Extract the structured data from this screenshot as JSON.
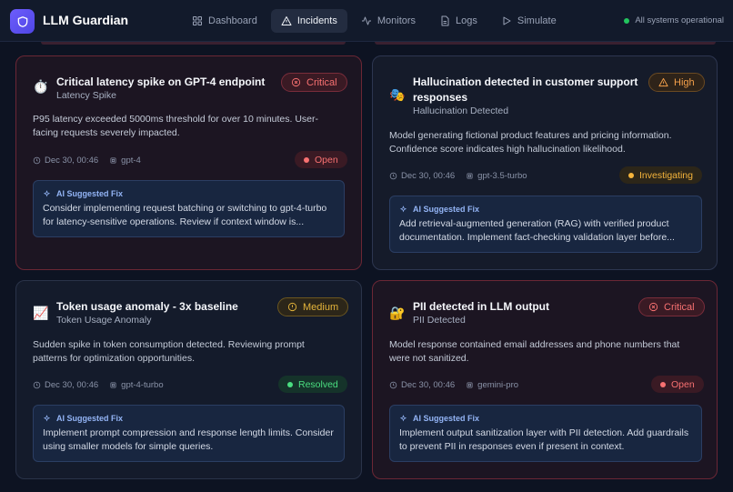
{
  "app": {
    "name": "LLM Guardian"
  },
  "nav": [
    {
      "label": "Dashboard",
      "icon": "dashboard-icon",
      "active": false
    },
    {
      "label": "Incidents",
      "icon": "alert-triangle-icon",
      "active": true
    },
    {
      "label": "Monitors",
      "icon": "activity-icon",
      "active": false
    },
    {
      "label": "Logs",
      "icon": "file-icon",
      "active": false
    },
    {
      "label": "Simulate",
      "icon": "play-icon",
      "active": false
    }
  ],
  "system_status": {
    "text": "All systems operational",
    "color": "#22c55e"
  },
  "fix_label": "AI Suggested Fix",
  "incidents": [
    {
      "emoji": "⏱️",
      "title": "Critical latency spike on GPT-4 endpoint",
      "category": "Latency Spike",
      "severity": "Critical",
      "description": "P95 latency exceeded 5000ms threshold for over 10 minutes. User-facing requests severely impacted.",
      "time": "Dec 30, 00:46",
      "model": "gpt-4",
      "status": "Open",
      "fix": "Consider implementing request batching or switching to gpt-4-turbo for latency-sensitive operations. Review if context window is..."
    },
    {
      "emoji": "🎭",
      "title": "Hallucination detected in customer support responses",
      "category": "Hallucination Detected",
      "severity": "High",
      "description": "Model generating fictional product features and pricing information. Confidence score indicates high hallucination likelihood.",
      "time": "Dec 30, 00:46",
      "model": "gpt-3.5-turbo",
      "status": "Investigating",
      "fix": "Add retrieval-augmented generation (RAG) with verified product documentation. Implement fact-checking validation layer before..."
    },
    {
      "emoji": "📈",
      "title": "Token usage anomaly - 3x baseline",
      "category": "Token Usage Anomaly",
      "severity": "Medium",
      "description": "Sudden spike in token consumption detected. Reviewing prompt patterns for optimization opportunities.",
      "time": "Dec 30, 00:46",
      "model": "gpt-4-turbo",
      "status": "Resolved",
      "fix": "Implement prompt compression and response length limits. Consider using smaller models for simple queries."
    },
    {
      "emoji": "🔐",
      "title": "PII detected in LLM output",
      "category": "PII Detected",
      "severity": "Critical",
      "description": "Model response contained email addresses and phone numbers that were not sanitized.",
      "time": "Dec 30, 00:46",
      "model": "gemini-pro",
      "status": "Open",
      "fix": "Implement output sanitization layer with PII detection. Add guardrails to prevent PII in responses even if present in context."
    }
  ]
}
